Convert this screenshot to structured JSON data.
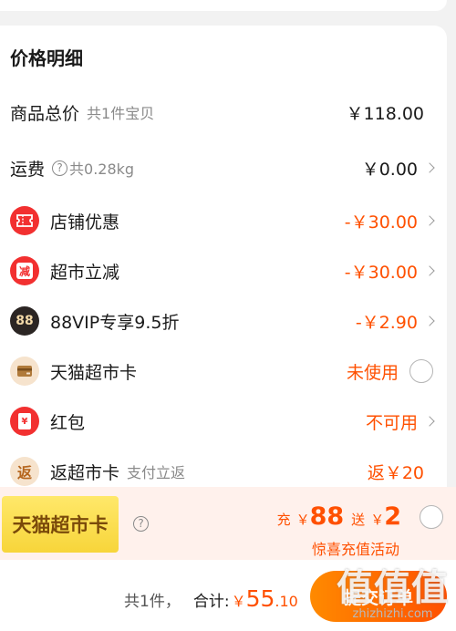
{
  "section_title": "价格明细",
  "rows": {
    "goods_total": {
      "label": "商品总价",
      "sub": "共1件宝贝",
      "amount": "￥118.00"
    },
    "shipping": {
      "label": "运费",
      "qmark": "?",
      "sub": "共0.28kg",
      "amount": "￥0.00"
    },
    "shop_discount": {
      "label": "店铺优惠",
      "amount": "-￥30.00"
    },
    "market_cut": {
      "label": "超市立减",
      "icon_text": "减",
      "amount": "-￥30.00"
    },
    "vip": {
      "label": "88VIP专享9.5折",
      "icon_text": "88",
      "amount": "-￥2.90"
    },
    "card": {
      "label": "天猫超市卡",
      "amount": "未使用"
    },
    "hongbao": {
      "label": "红包",
      "icon_text": "¥",
      "amount": "不可用"
    },
    "rebate": {
      "label": "返超市卡",
      "icon_text": "返",
      "sub": "支付立返",
      "amount": "返￥20"
    }
  },
  "promo": {
    "badge": "天猫超市卡",
    "qmark": "?",
    "charge_label": "充",
    "charge_cur": "￥",
    "charge_value": "88",
    "gift_label": "送",
    "gift_cur": "￥",
    "gift_value": "2",
    "sub": "惊喜充值活动"
  },
  "bottom": {
    "count": "共1件，",
    "total_label": "合计:",
    "currency": "￥",
    "total_int": "55",
    "total_dec": ".10",
    "submit": "提交订单"
  },
  "watermark": {
    "logo": "值值值",
    "url": "zhizhizhi.com"
  },
  "colors": {
    "accent": "#ff5000",
    "icon_red": "#f23030",
    "promo_bg": "#fff1ec",
    "badge_yellow": "#f7d53a"
  },
  "icons": {
    "shop_discount": "coupon-icon",
    "card": "wallet-card-icon",
    "hongbao": "red-envelope-icon",
    "chevron": "chevron-right-icon",
    "help": "question-circle-icon"
  }
}
